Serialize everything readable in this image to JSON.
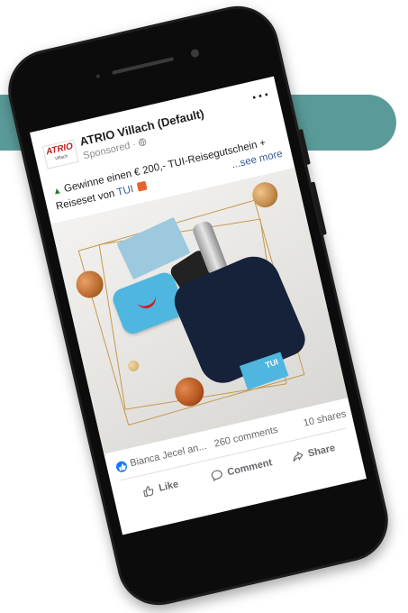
{
  "post": {
    "page_name": "ATRIO Villach (Default)",
    "logo_text": "ATRIO",
    "logo_subtext": "Villach",
    "sponsored": "Sponsored · ",
    "globe_icon": "globe-icon",
    "more_menu": "···",
    "caption_line1": "Gewinne einen € 200,- TUI-Reisegutschein +",
    "caption_line2_prefix": "Reiseset von ",
    "caption_link": "TUI",
    "see_more": "...see more",
    "photo_tui_label": "TUI",
    "reactions_text": "Bianca Jecel an...",
    "comments": "260 comments",
    "shares": "10 shares",
    "like_label": "Like",
    "comment_label": "Comment",
    "share_label": "Share"
  },
  "colors": {
    "teal_band": "#5a9b99",
    "facebook_blue": "#1877f2",
    "link_blue": "#385898",
    "gold_frame": "#c59a4e",
    "ornament_bronze": "#b86a2c",
    "tui_cyan": "#4fb6e0",
    "tui_red": "#d71920"
  },
  "icons": [
    "tree-emoji-icon",
    "gift-emoji-icon",
    "globe-icon",
    "like-icon",
    "comment-icon",
    "share-icon",
    "reaction-like-icon"
  ]
}
